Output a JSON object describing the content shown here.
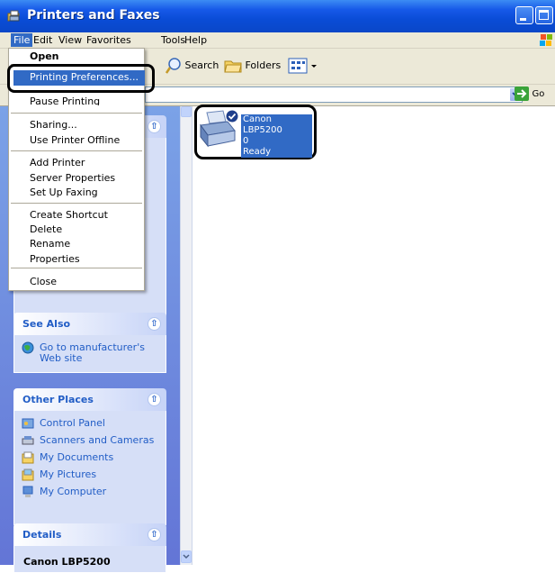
{
  "window": {
    "title": "Printers and Faxes",
    "icon": "printers-folder-icon"
  },
  "menubar": {
    "items": [
      {
        "label": "File",
        "name": "menu-file"
      },
      {
        "label": "Edit",
        "name": "menu-edit"
      },
      {
        "label": "View",
        "name": "menu-view"
      },
      {
        "label": "Favorites",
        "name": "menu-favorites"
      },
      {
        "label": "Tools",
        "name": "menu-tools"
      },
      {
        "label": "Help",
        "name": "menu-help"
      }
    ]
  },
  "toolbar": {
    "search_label": "Search",
    "folders_label": "Folders",
    "views_icon": "views-icon"
  },
  "address": {
    "go_label": "Go"
  },
  "file_menu": {
    "items": [
      "Open",
      "Printing Preferences...",
      "Pause Printing",
      "Sharing...",
      "Use Printer Offline",
      "Add Printer",
      "Server Properties",
      "Set Up Faxing",
      "Create Shortcut",
      "Delete",
      "Rename",
      "Properties",
      "Close"
    ]
  },
  "task_pane": {
    "see_also": {
      "title": "See Also",
      "tasks": [
        "Go to manufacturer's",
        "Web site"
      ]
    },
    "other_places": {
      "title": "Other Places",
      "tasks": [
        "Control Panel",
        "Scanners and Cameras",
        "My Documents",
        "My Pictures",
        "My Computer"
      ]
    },
    "details": {
      "title": "Details",
      "partial_text": "Canon LBP5200"
    }
  },
  "printer": {
    "name": "Canon LBP5200",
    "jobs": "0",
    "status": "Ready"
  },
  "colors": {
    "titlebar": "#0a4cd6",
    "selection": "#316ac5",
    "taskpane": "#7ba2e7",
    "task_link": "#215dc6"
  }
}
